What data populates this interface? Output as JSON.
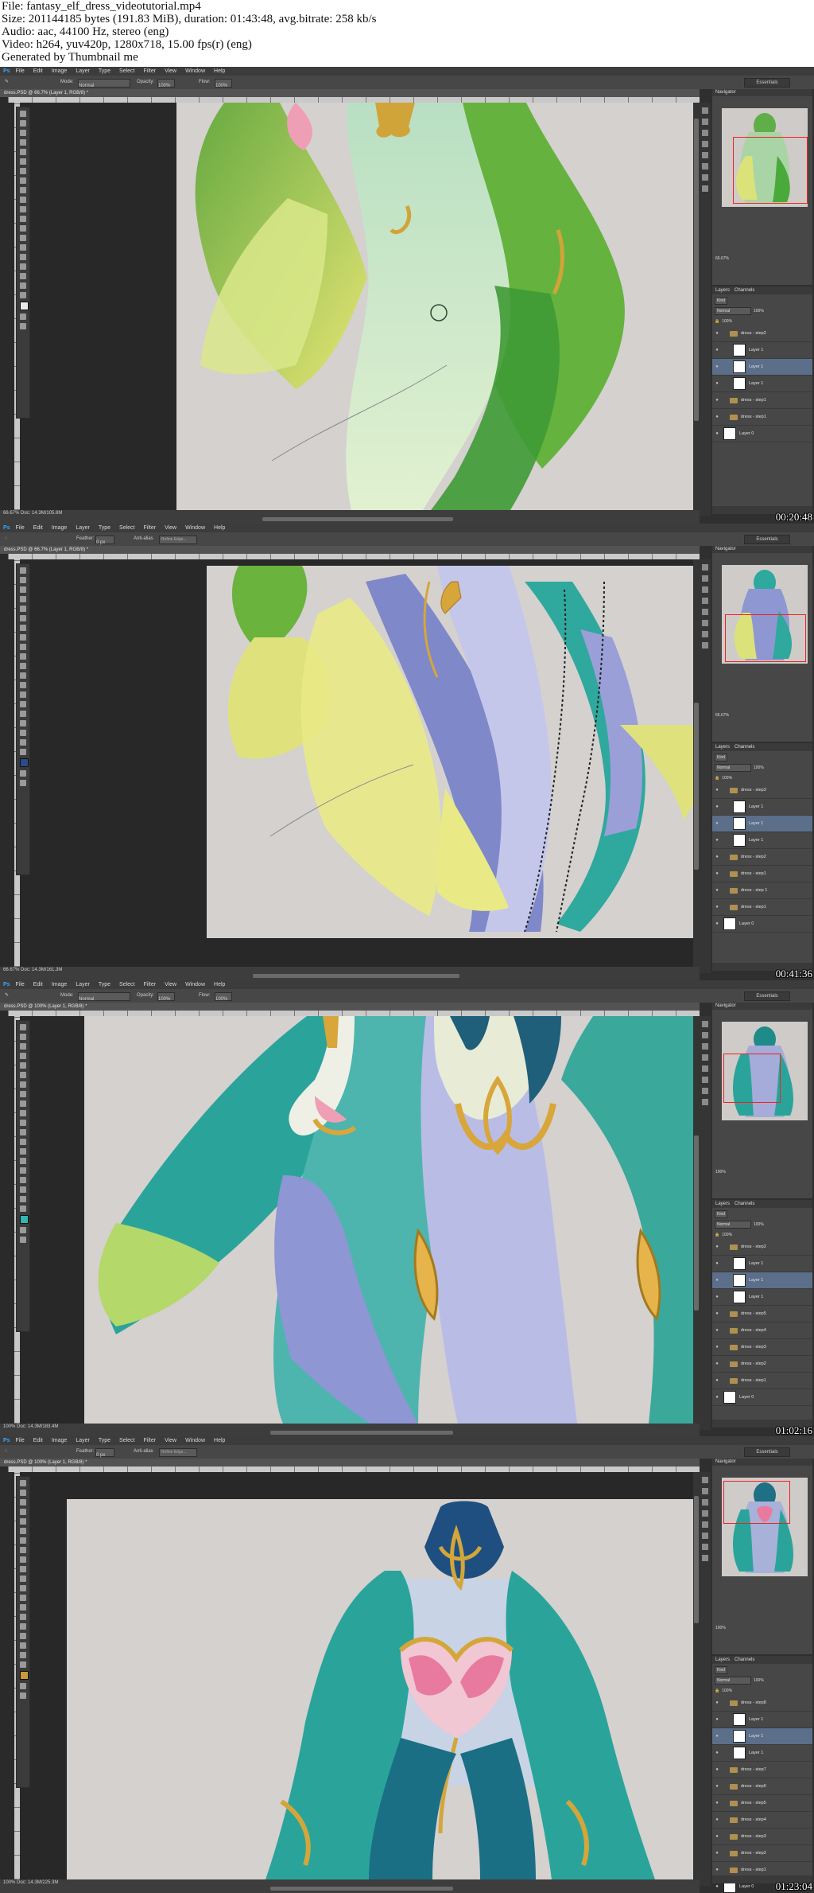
{
  "header": {
    "file": "File: fantasy_elf_dress_videotutorial.mp4",
    "size": "Size: 201144185 bytes (191.83 MiB), duration: 01:43:48, avg.bitrate: 258 kb/s",
    "audio": "Audio: aac, 44100 Hz, stereo (eng)",
    "video": "Video: h264, yuv420p, 1280x718, 15.00 fps(r) (eng)",
    "generated": "Generated by Thumbnail me"
  },
  "app": {
    "logo": "Ps",
    "menu": [
      "File",
      "Edit",
      "Image",
      "Layer",
      "Type",
      "Select",
      "Filter",
      "View",
      "Window",
      "Help"
    ],
    "workspace": "Essentials",
    "nav_title": "Navigator",
    "layers_tabs": [
      "Layers",
      "Channels"
    ]
  },
  "frames": [
    {
      "timestamp": "00:20:48",
      "doc_tab": "dress.PSD @ 66.7% (Layer 1, RGB/8) *",
      "zoom": "66.67%",
      "status": "66.67%   Doc: 14.3M/105.8M",
      "options": {
        "mode_label": "Mode:",
        "mode": "Normal",
        "opacity_label": "Opacity:",
        "opacity": "100%",
        "flow_label": "Flow:",
        "flow": "100%"
      },
      "blend": "Normal",
      "layer_opacity": "100%",
      "fill": "100%",
      "kind": "Kind",
      "layers": [
        {
          "name": "dress - step2",
          "type": "group",
          "selected": false
        },
        {
          "name": "Layer 1",
          "type": "layer",
          "selected": false
        },
        {
          "name": "Layer 1",
          "type": "layer",
          "selected": true
        },
        {
          "name": "Layer 1",
          "type": "layer",
          "selected": false
        },
        {
          "name": "dress - step1",
          "type": "group",
          "selected": false
        },
        {
          "name": "dress - step1",
          "type": "group",
          "selected": false
        },
        {
          "name": "Layer 0",
          "type": "layer",
          "selected": false
        }
      ]
    },
    {
      "timestamp": "00:41:36",
      "doc_tab": "dress.PSD @ 66.7% (Layer 1, RGB/8) *",
      "zoom": "66.67%",
      "status": "66.67%   Doc: 14.3M/161.3M",
      "options": {
        "mode_label": "Feather:",
        "mode": "0 px",
        "opacity_label": "Anti-alias",
        "opacity": "",
        "flow_label": "Refine Edge...",
        "flow": ""
      },
      "blend": "Normal",
      "layer_opacity": "100%",
      "fill": "100%",
      "kind": "Kind",
      "layers": [
        {
          "name": "dress - step3",
          "type": "group",
          "selected": false
        },
        {
          "name": "Layer 1",
          "type": "layer",
          "selected": false
        },
        {
          "name": "Layer 1",
          "type": "layer",
          "selected": true
        },
        {
          "name": "Layer 1",
          "type": "layer",
          "selected": false
        },
        {
          "name": "dress - step2",
          "type": "group",
          "selected": false
        },
        {
          "name": "dress - step1",
          "type": "group",
          "selected": false
        },
        {
          "name": "dress - step 1",
          "type": "group",
          "selected": false
        },
        {
          "name": "dress - step1",
          "type": "group",
          "selected": false
        },
        {
          "name": "Layer 0",
          "type": "layer",
          "selected": false
        }
      ]
    },
    {
      "timestamp": "01:02:16",
      "doc_tab": "dress.PSD @ 100% (Layer 1, RGB/8) *",
      "zoom": "100%",
      "status": "100%   Doc: 14.3M/183.4M",
      "options": {
        "mode_label": "Mode:",
        "mode": "Normal",
        "opacity_label": "Opacity:",
        "opacity": "100%",
        "flow_label": "Flow:",
        "flow": "100%"
      },
      "blend": "Normal",
      "layer_opacity": "100%",
      "fill": "100%",
      "kind": "Kind",
      "layers": [
        {
          "name": "dress - step2",
          "type": "group",
          "selected": false
        },
        {
          "name": "Layer 1",
          "type": "layer",
          "selected": false
        },
        {
          "name": "Layer 1",
          "type": "layer",
          "selected": true
        },
        {
          "name": "Layer 1",
          "type": "layer",
          "selected": false
        },
        {
          "name": "dress - step5",
          "type": "group",
          "selected": false
        },
        {
          "name": "dress - step4",
          "type": "group",
          "selected": false
        },
        {
          "name": "dress - step3",
          "type": "group",
          "selected": false
        },
        {
          "name": "dress - step2",
          "type": "group",
          "selected": false
        },
        {
          "name": "dress - step1",
          "type": "group",
          "selected": false
        },
        {
          "name": "Layer 0",
          "type": "layer",
          "selected": false
        }
      ]
    },
    {
      "timestamp": "01:23:04",
      "doc_tab": "dress.PSD @ 100% (Layer 1, RGB/8) *",
      "zoom": "100%",
      "status": "100%   Doc: 14.3M/225.3M",
      "options": {
        "mode_label": "Feather:",
        "mode": "0 px",
        "opacity_label": "Anti-alias",
        "opacity": "",
        "flow_label": "Refine Edge...",
        "flow": ""
      },
      "blend": "Normal",
      "layer_opacity": "100%",
      "fill": "100%",
      "kind": "Kind",
      "layers": [
        {
          "name": "dress - step8",
          "type": "group",
          "selected": false
        },
        {
          "name": "Layer 1",
          "type": "layer",
          "selected": false
        },
        {
          "name": "Layer 1",
          "type": "layer",
          "selected": true
        },
        {
          "name": "Layer 1",
          "type": "layer",
          "selected": false
        },
        {
          "name": "dress - step7",
          "type": "group",
          "selected": false
        },
        {
          "name": "dress - step6",
          "type": "group",
          "selected": false
        },
        {
          "name": "dress - step5",
          "type": "group",
          "selected": false
        },
        {
          "name": "dress - step4",
          "type": "group",
          "selected": false
        },
        {
          "name": "dress - step3",
          "type": "group",
          "selected": false
        },
        {
          "name": "dress - step2",
          "type": "group",
          "selected": false
        },
        {
          "name": "dress - step1",
          "type": "group",
          "selected": false
        },
        {
          "name": "Layer 0",
          "type": "layer",
          "selected": false
        }
      ]
    }
  ],
  "colors": {
    "ps_blue": "#34a7ff",
    "canvas_bg": "#d4d1cf",
    "selected_layer": "#5b6e8a",
    "nav_rect": "#e22222",
    "leaf_green": "#6db33f",
    "teal": "#1fa7a1",
    "lavender": "#9aa3d6",
    "gold": "#d4a63a",
    "pink": "#e896b0"
  }
}
